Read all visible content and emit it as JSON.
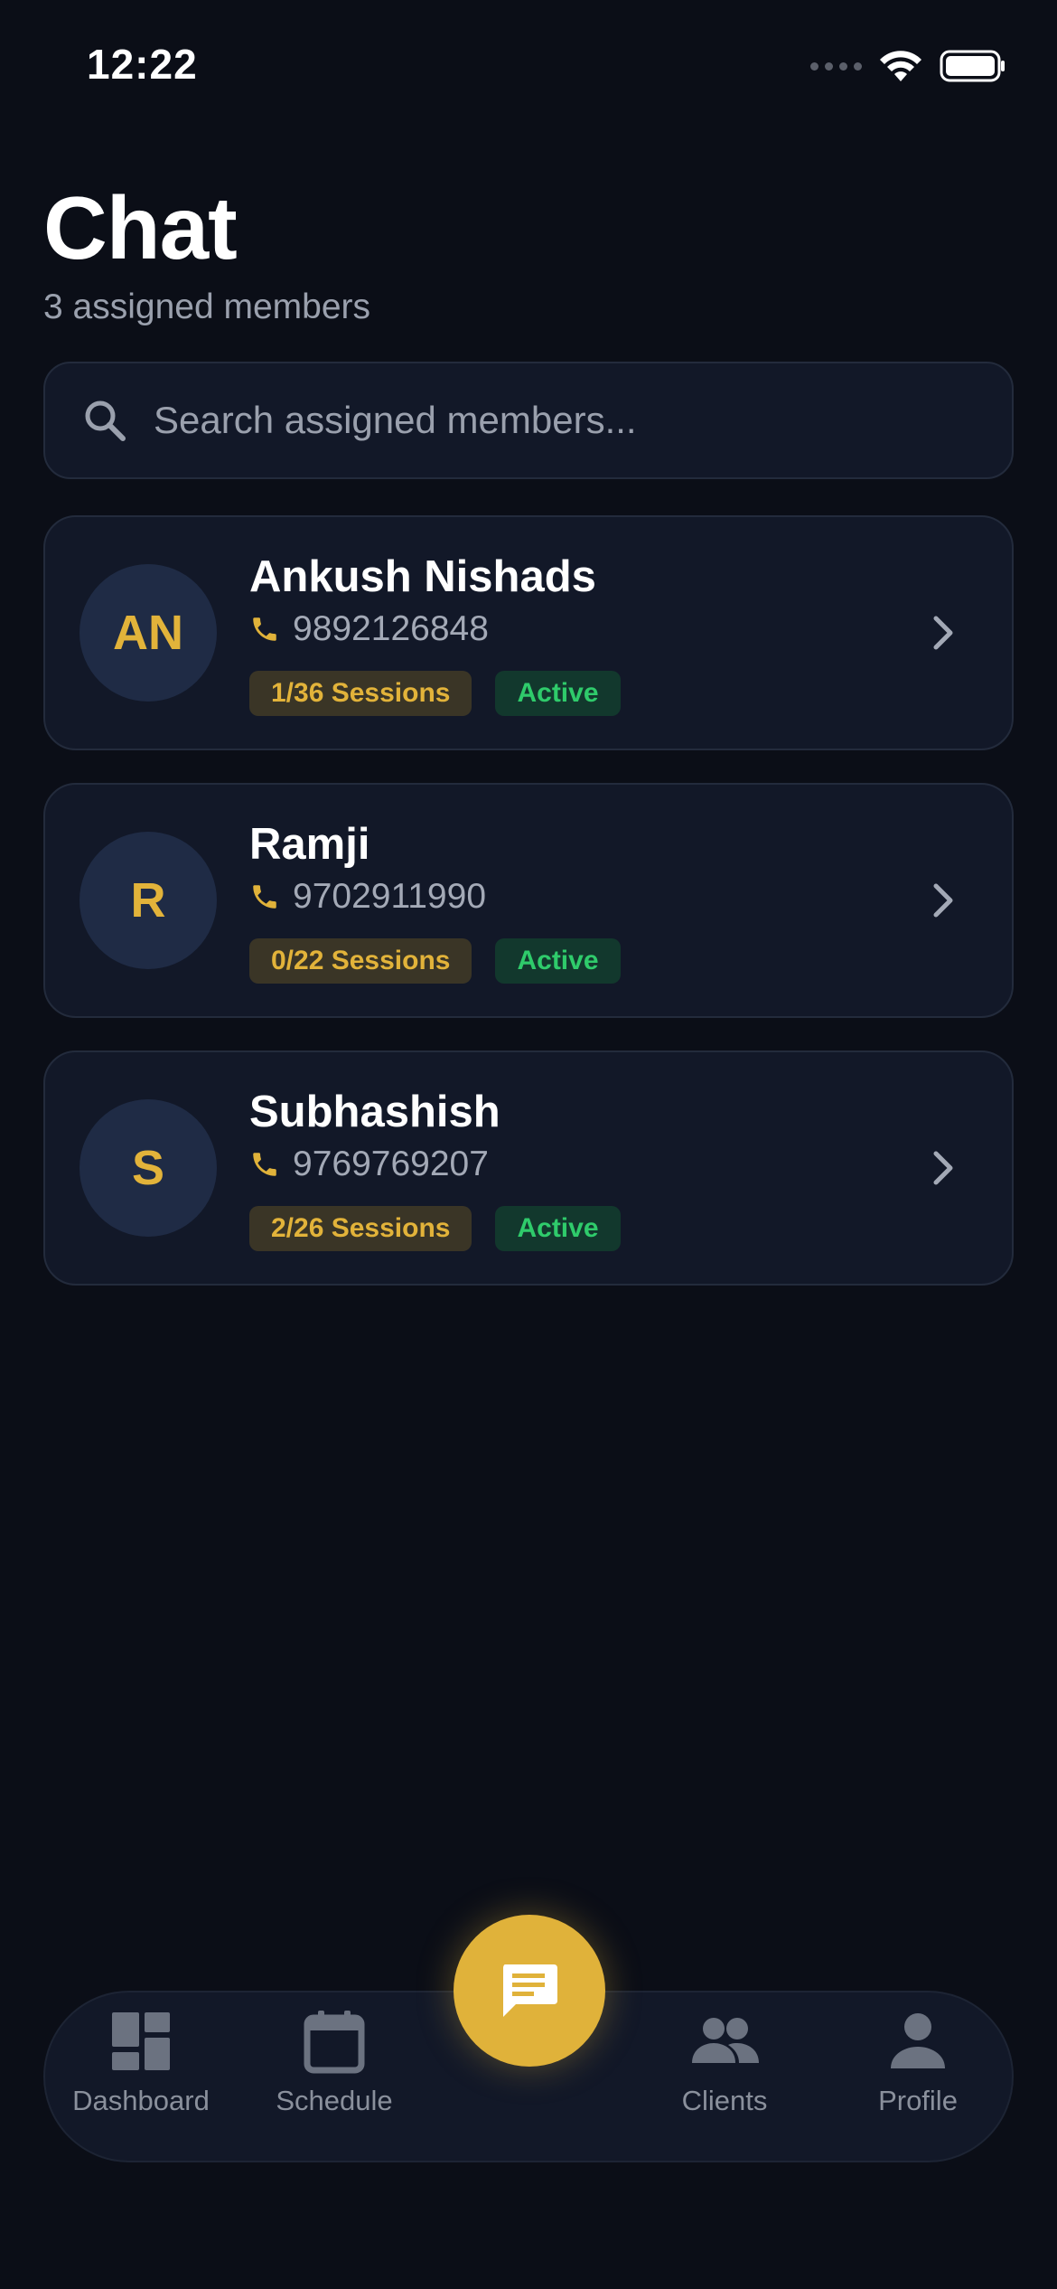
{
  "status_bar": {
    "time": "12:22"
  },
  "header": {
    "title": "Chat",
    "subtitle": "3 assigned members"
  },
  "search": {
    "placeholder": "Search assigned members..."
  },
  "members": [
    {
      "initials": "AN",
      "name": "Ankush Nishads",
      "phone": "9892126848",
      "sessions": "1/36 Sessions",
      "status": "Active"
    },
    {
      "initials": "R",
      "name": "Ramji",
      "phone": "9702911990",
      "sessions": "0/22 Sessions",
      "status": "Active"
    },
    {
      "initials": "S",
      "name": "Subhashish",
      "phone": "9769769207",
      "sessions": "2/26 Sessions",
      "status": "Active"
    }
  ],
  "nav": {
    "items": [
      {
        "label": "Dashboard",
        "icon": "dashboard-icon"
      },
      {
        "label": "Schedule",
        "icon": "calendar-icon"
      },
      {
        "label": "Clients",
        "icon": "people-icon"
      },
      {
        "label": "Profile",
        "icon": "person-icon"
      }
    ],
    "fab_icon": "chat-icon"
  },
  "colors": {
    "background": "#0b0e17",
    "card": "#121828",
    "accent": "#e0b23a",
    "active_green": "#2fcb6b",
    "muted_text": "#9aa0ad"
  }
}
